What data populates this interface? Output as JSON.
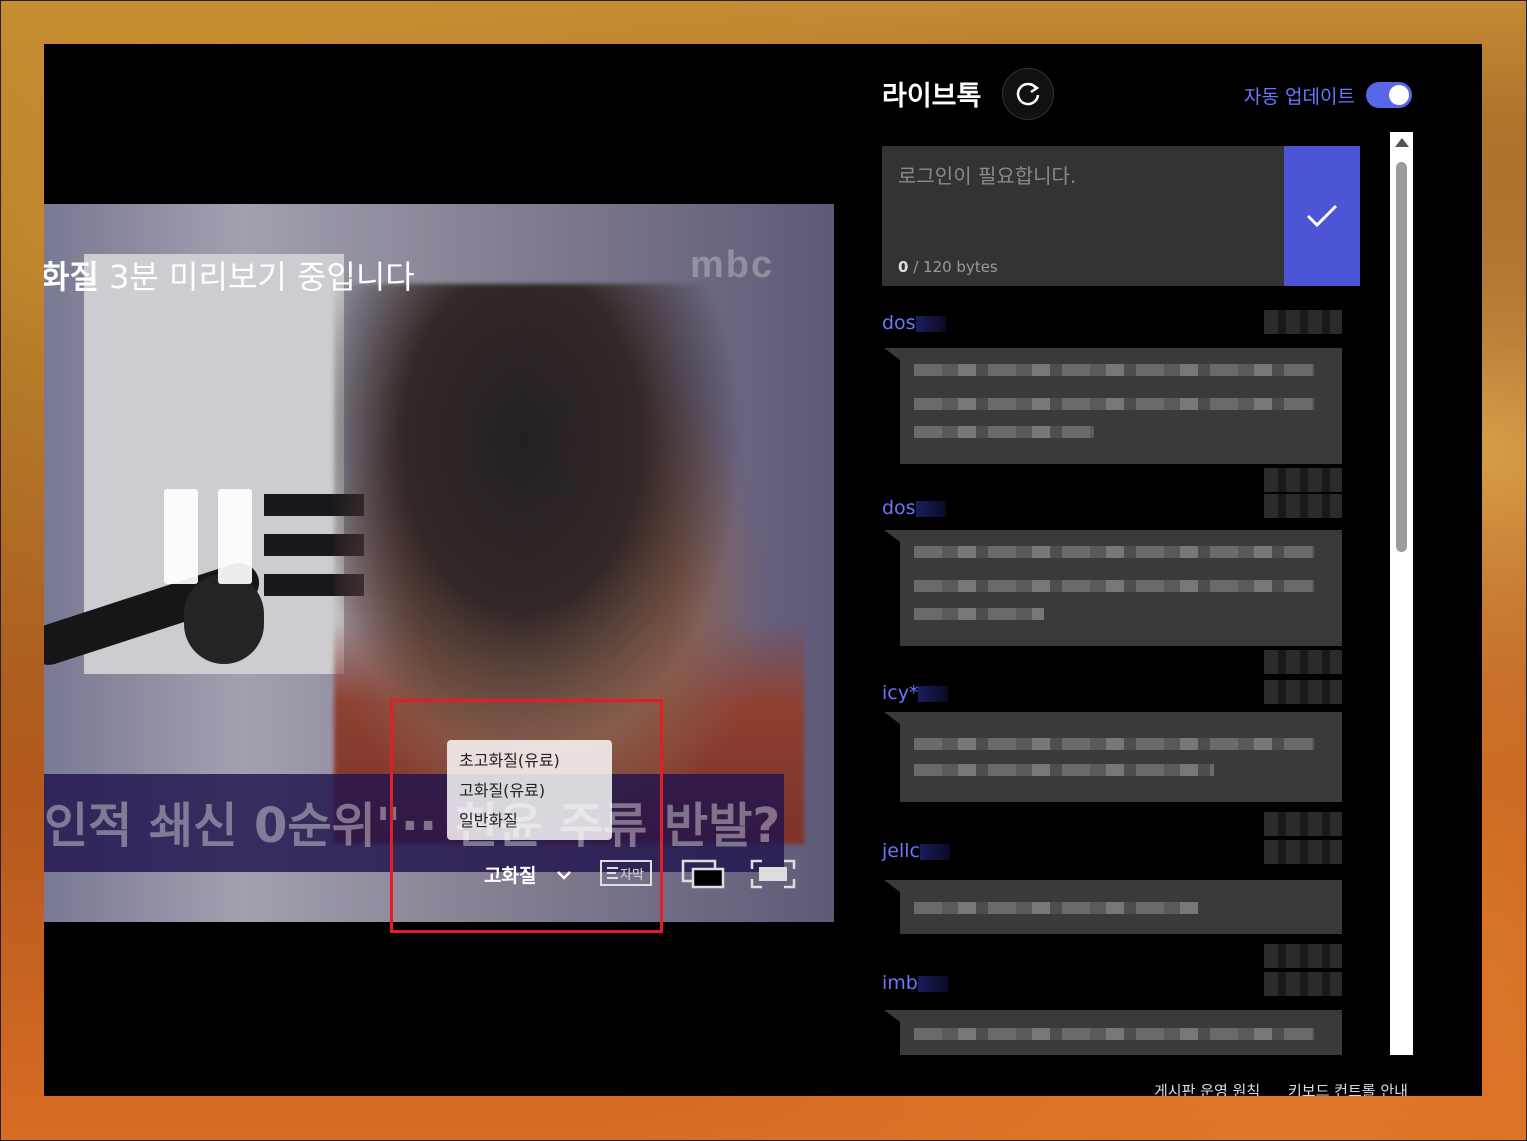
{
  "player": {
    "preview_bold": "화질",
    "preview_text": " 3분 미리보기 중입니다",
    "channel_logo": "mbc",
    "banner_text": "인적 쇄신 0순위\"·· 친윤 주류 반발?",
    "quality_options": [
      "초고화질(유료)",
      "고화질(유료)",
      "일반화질"
    ],
    "current_quality": "고화질",
    "subtitle_label": "자막",
    "icons": {
      "pause": "pause-icon",
      "chevron": "chevron-down-icon",
      "subtitle": "subtitle-icon",
      "pip": "picture-in-picture-icon",
      "fullscreen": "fullscreen-icon"
    }
  },
  "chat": {
    "title": "라이브톡",
    "auto_update_label": "자동 업데이트",
    "auto_update_on": true,
    "input_placeholder": "로그인이 필요합니다.",
    "byte_count": "0",
    "byte_limit": " / 120 bytes",
    "messages": [
      {
        "user": "dos"
      },
      {
        "user": "dos"
      },
      {
        "user": "icy*"
      },
      {
        "user": "jellc"
      },
      {
        "user": "imb"
      }
    ]
  },
  "footer": {
    "board_rules": "게시판 운영 원칙",
    "keyboard_help": "키보드 컨트롤 안내"
  },
  "colors": {
    "accent": "#5866e8",
    "highlight": "#e21d25",
    "username": "#6a76ff"
  }
}
